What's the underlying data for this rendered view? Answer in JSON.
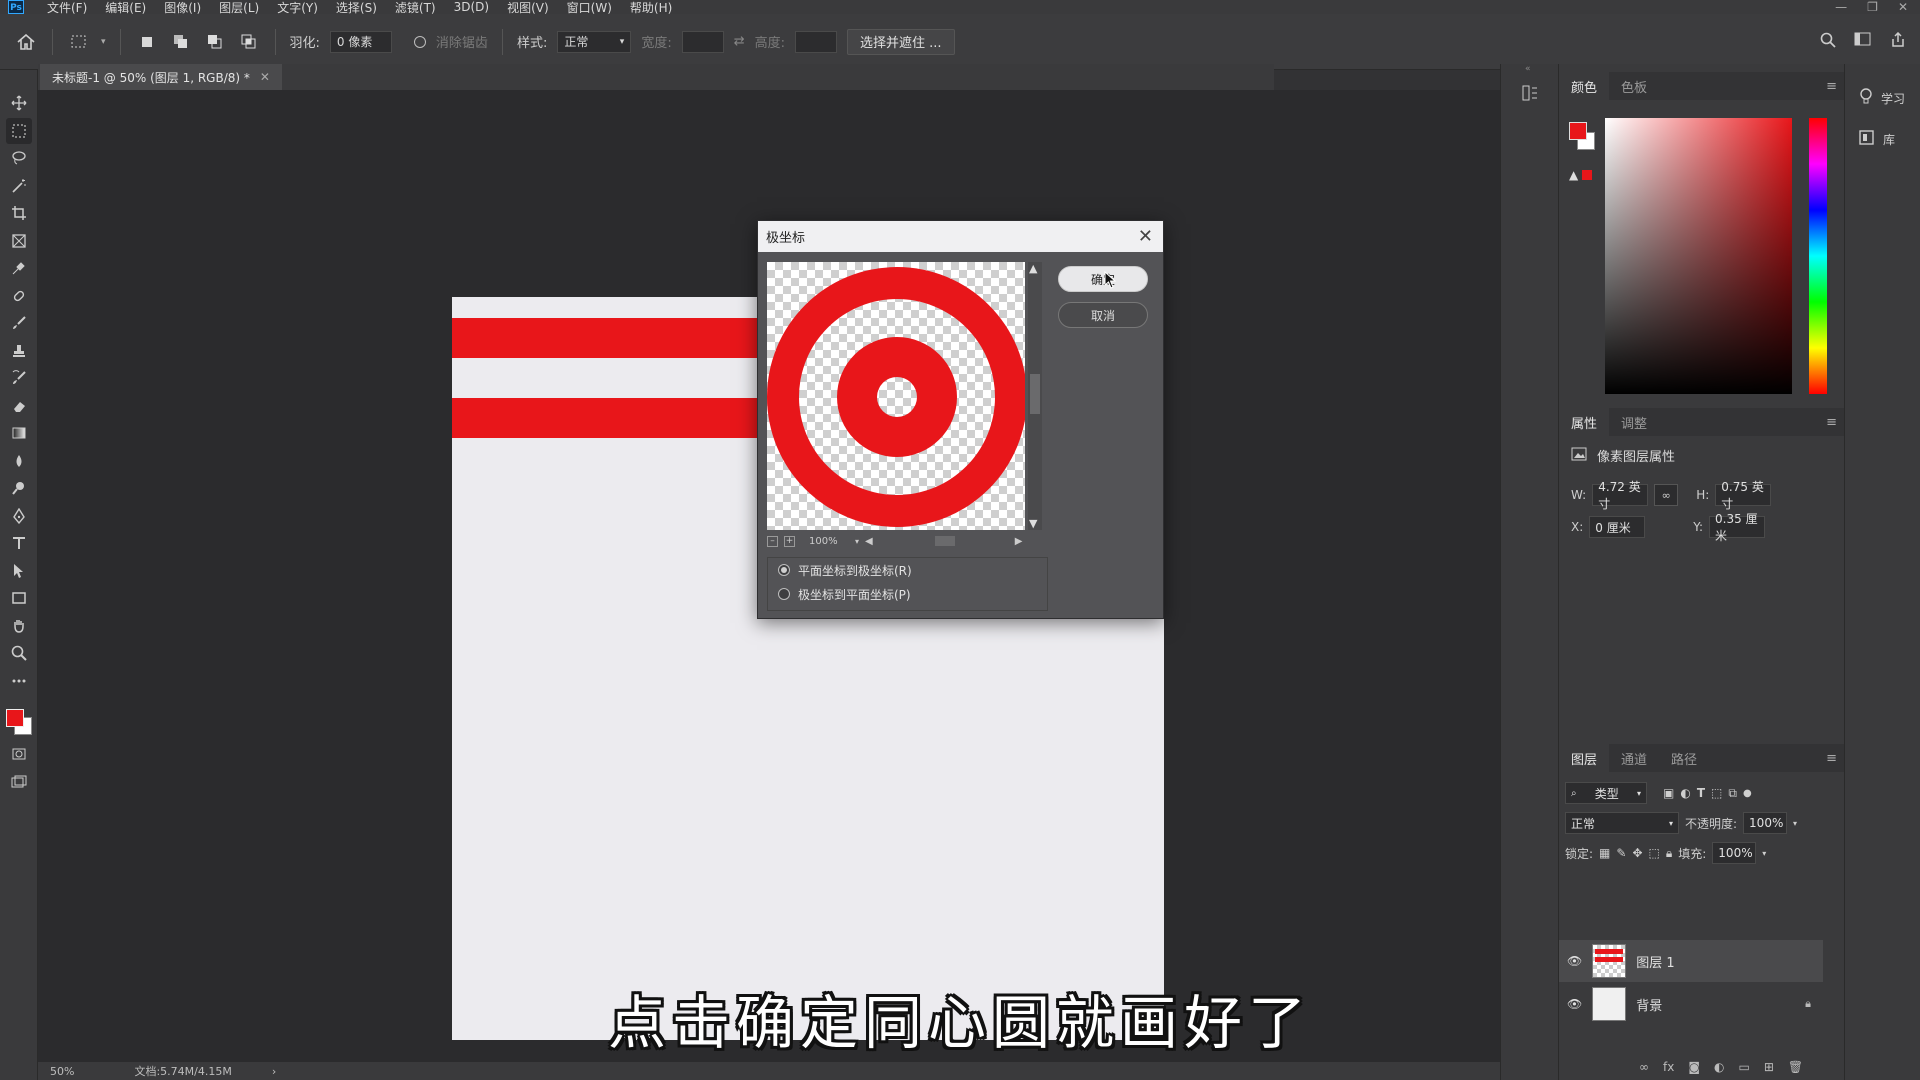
{
  "app": {
    "logo": "Ps"
  },
  "menu": [
    "文件(F)",
    "编辑(E)",
    "图像(I)",
    "图层(L)",
    "文字(Y)",
    "选择(S)",
    "滤镜(T)",
    "3D(D)",
    "视图(V)",
    "窗口(W)",
    "帮助(H)"
  ],
  "options": {
    "feather_label": "羽化:",
    "feather_value": "0 像素",
    "antialias_label": "消除锯齿",
    "style_label": "样式:",
    "style_value": "正常",
    "width_label": "宽度:",
    "height_label": "高度:",
    "select_mask": "选择并遮住 ..."
  },
  "document": {
    "tab_title": "未标题-1 @ 50% (图层 1, RGB/8) *",
    "stripe_color": "#e8161a",
    "canvas_color": "#ecebef"
  },
  "status": {
    "zoom": "50%",
    "doc": "文档:5.74M/4.15M"
  },
  "dialog": {
    "title": "极坐标",
    "ok": "确定",
    "cancel": "取消",
    "zoom": "100%",
    "option1": "平面坐标到极坐标(R)",
    "option2": "极坐标到平面坐标(P)"
  },
  "color_panel": {
    "tabs": [
      "颜色",
      "色板"
    ],
    "fg": "#e8161a",
    "bg": "#ffffff"
  },
  "properties_panel": {
    "tabs": [
      "属性",
      "调整"
    ],
    "title": "像素图层属性",
    "w_label": "W:",
    "w_value": "4.72 英寸",
    "h_label": "H:",
    "h_value": "0.75 英寸",
    "x_label": "X:",
    "x_value": "0 厘米",
    "y_label": "Y:",
    "y_value": "0.35 厘米"
  },
  "layers_panel": {
    "tabs": [
      "图层",
      "通道",
      "路径"
    ],
    "filter": "类型",
    "blend": "正常",
    "opacity_label": "不透明度:",
    "opacity_value": "100%",
    "lock_label": "锁定:",
    "fill_label": "填充:",
    "fill_value": "100%",
    "layers": [
      {
        "name": "图层 1"
      },
      {
        "name": "背景"
      }
    ]
  },
  "right_strip": {
    "learn": "学习",
    "library": "库"
  },
  "subtitle": "点击确定同心圆就画好了"
}
